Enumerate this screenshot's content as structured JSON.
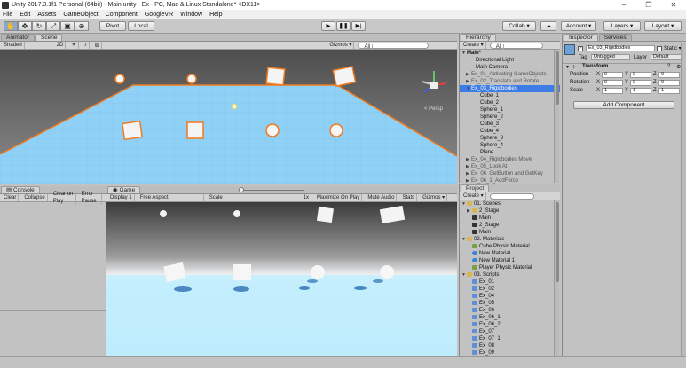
{
  "window": {
    "title": "Unity 2017.3.1f1 Personal (64bit) - Main.unity - Ex - PC, Mac & Linux Standalone* <DX11>",
    "minimize": "–",
    "maximize": "❐",
    "close": "✕"
  },
  "menu": [
    "File",
    "Edit",
    "Assets",
    "GameObject",
    "Component",
    "GoogleVR",
    "Window",
    "Help"
  ],
  "toolbar": {
    "pivot": "Pivot",
    "local": "Local",
    "collab": "Collab ▾",
    "account": "Account ▾",
    "layers": "Layers ▾",
    "layout": "Layout ▾"
  },
  "scene": {
    "tabs": [
      "Animator",
      "Scene"
    ],
    "shading": "Shaded",
    "mode2d": "2D",
    "gizmos": "Gizmos ▾",
    "search": "All",
    "persp": "< Persp"
  },
  "console": {
    "tab": "Console",
    "buttons": [
      "Clear",
      "Collapse",
      "Clear on Play",
      "Error Pause"
    ]
  },
  "game": {
    "tab": "Game",
    "display": "Display 1",
    "aspect": "Free Aspect",
    "scale_label": "Scale",
    "scale_value": "1x",
    "buttons": [
      "Maximize On Play",
      "Mute Audio",
      "Stats",
      "Gizmos ▾"
    ]
  },
  "hierarchy": {
    "tab": "Hierarchy",
    "create": "Create ▾",
    "search": "All",
    "items": [
      {
        "label": "Main*",
        "indent": 0,
        "arrow": "▼",
        "bold": true
      },
      {
        "label": "Directional Light",
        "indent": 2,
        "arrow": ""
      },
      {
        "label": "Main Camera",
        "indent": 2,
        "arrow": ""
      },
      {
        "label": "Ex_01_Activating GameObjects",
        "indent": 1,
        "arrow": "▶",
        "gray": true
      },
      {
        "label": "Ex_02_Translate and Rotate",
        "indent": 1,
        "arrow": "▶",
        "gray": true
      },
      {
        "label": "Ex_03_Rigidbodies",
        "indent": 1,
        "arrow": "▼",
        "selected": true
      },
      {
        "label": "Cube_1",
        "indent": 3,
        "arrow": ""
      },
      {
        "label": "Cube_2",
        "indent": 3,
        "arrow": ""
      },
      {
        "label": "Sphere_1",
        "indent": 3,
        "arrow": ""
      },
      {
        "label": "Sphere_2",
        "indent": 3,
        "arrow": ""
      },
      {
        "label": "Cube_3",
        "indent": 3,
        "arrow": ""
      },
      {
        "label": "Cube_4",
        "indent": 3,
        "arrow": ""
      },
      {
        "label": "Sphere_3",
        "indent": 3,
        "arrow": ""
      },
      {
        "label": "Sphere_4",
        "indent": 3,
        "arrow": ""
      },
      {
        "label": "Plane",
        "indent": 3,
        "arrow": ""
      },
      {
        "label": "Ex_04_Rigidbodies Move",
        "indent": 1,
        "arrow": "▶",
        "gray": true
      },
      {
        "label": "Ex_05_Look At",
        "indent": 1,
        "arrow": "▶",
        "gray": true
      },
      {
        "label": "Ex_06_GetButton and GetKey",
        "indent": 1,
        "arrow": "▶",
        "gray": true
      },
      {
        "label": "Ex_06_1_AddForce",
        "indent": 1,
        "arrow": "▶",
        "gray": true
      }
    ]
  },
  "project": {
    "tab": "Project",
    "create": "Create ▾",
    "items": [
      {
        "label": "01. Scenes",
        "indent": 0,
        "arrow": "▼",
        "icon": "folder"
      },
      {
        "label": "2_Stage",
        "indent": 1,
        "arrow": "▶",
        "icon": "folder"
      },
      {
        "label": "Main",
        "indent": 1,
        "arrow": "",
        "icon": "unity"
      },
      {
        "label": "2_Stage",
        "indent": 1,
        "arrow": "",
        "icon": "unity"
      },
      {
        "label": "Main",
        "indent": 1,
        "arrow": "",
        "icon": "unity"
      },
      {
        "label": "02. Materials",
        "indent": 0,
        "arrow": "▼",
        "icon": "folder"
      },
      {
        "label": "Cube Physic Material",
        "indent": 1,
        "arrow": "",
        "icon": "physic"
      },
      {
        "label": "New Material",
        "indent": 1,
        "arrow": "",
        "icon": "material"
      },
      {
        "label": "New Material 1",
        "indent": 1,
        "arrow": "",
        "icon": "material"
      },
      {
        "label": "Player Physic Material",
        "indent": 1,
        "arrow": "",
        "icon": "physic"
      },
      {
        "label": "03. Scripts",
        "indent": 0,
        "arrow": "▼",
        "icon": "folder"
      },
      {
        "label": "Ex_01",
        "indent": 1,
        "arrow": "",
        "icon": "script"
      },
      {
        "label": "Ex_02",
        "indent": 1,
        "arrow": "",
        "icon": "script"
      },
      {
        "label": "Ex_04",
        "indent": 1,
        "arrow": "",
        "icon": "script"
      },
      {
        "label": "Ex_05",
        "indent": 1,
        "arrow": "",
        "icon": "script"
      },
      {
        "label": "Ex_06",
        "indent": 1,
        "arrow": "",
        "icon": "script"
      },
      {
        "label": "Ex_06_1",
        "indent": 1,
        "arrow": "",
        "icon": "script"
      },
      {
        "label": "Ex_06_2",
        "indent": 1,
        "arrow": "",
        "icon": "script"
      },
      {
        "label": "Ex_07",
        "indent": 1,
        "arrow": "",
        "icon": "script"
      },
      {
        "label": "Ex_07_1",
        "indent": 1,
        "arrow": "",
        "icon": "script"
      },
      {
        "label": "Ex_08",
        "indent": 1,
        "arrow": "",
        "icon": "script"
      },
      {
        "label": "Ex_09",
        "indent": 1,
        "arrow": "",
        "icon": "script"
      }
    ]
  },
  "inspector": {
    "tabs": [
      "Inspector",
      "Services"
    ],
    "object_name": "Ex_03_Rigidbodies",
    "static": "Static ▾",
    "tag_label": "Tag",
    "tag_value": "Untagged",
    "layer_label": "Layer",
    "layer_value": "Default",
    "transform": "Transform",
    "rows": [
      {
        "label": "Position",
        "x": "0",
        "y": "0",
        "z": "0"
      },
      {
        "label": "Rotation",
        "x": "0",
        "y": "0",
        "z": "0"
      },
      {
        "label": "Scale",
        "x": "1",
        "y": "1",
        "z": "1"
      }
    ],
    "add_component": "Add Component"
  },
  "colors": {
    "selection": "#3e7ce6",
    "plane": "#8fd0f6",
    "sky": "#6a6a6a",
    "outline": "#f07a1e"
  }
}
